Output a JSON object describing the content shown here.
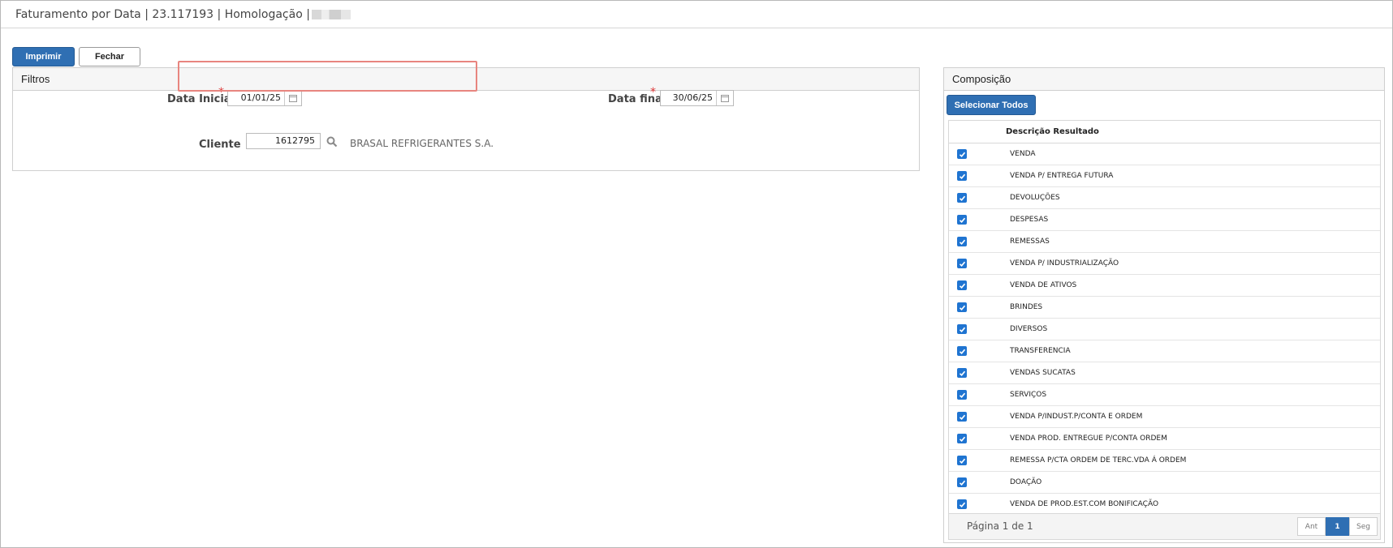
{
  "window": {
    "title": "Faturamento por Data | 23.117193 | Homologação |"
  },
  "toolbar": {
    "print_label": "Imprimir",
    "close_label": "Fechar"
  },
  "filtros": {
    "title": "Filtros",
    "data_inicial_label": "Data Inicial",
    "data_inicial_value": "01/01/25",
    "data_final_label": "Data final",
    "data_final_value": "30/06/25",
    "required_mark": "*",
    "cliente_label": "Cliente",
    "cliente_code": "1612795",
    "cliente_name": "BRASAL REFRIGERANTES S.A."
  },
  "composicao": {
    "title": "Composição",
    "select_all_label": "Selecionar Todos",
    "column_header": "Descrição Resultado",
    "items": [
      {
        "label": "VENDA",
        "checked": true
      },
      {
        "label": "VENDA P/ ENTREGA FUTURA",
        "checked": true
      },
      {
        "label": "DEVOLUÇÕES",
        "checked": true
      },
      {
        "label": "DESPESAS",
        "checked": true
      },
      {
        "label": "REMESSAS",
        "checked": true
      },
      {
        "label": "VENDA P/ INDUSTRIALIZAÇÃO",
        "checked": true
      },
      {
        "label": "VENDA DE ATIVOS",
        "checked": true
      },
      {
        "label": "BRINDES",
        "checked": true
      },
      {
        "label": "DIVERSOS",
        "checked": true
      },
      {
        "label": "TRANSFERENCIA",
        "checked": true
      },
      {
        "label": "VENDAS SUCATAS",
        "checked": true
      },
      {
        "label": "SERVIÇOS",
        "checked": true
      },
      {
        "label": "VENDA P/INDUST.P/CONTA E ORDEM",
        "checked": true
      },
      {
        "label": "VENDA PROD. ENTREGUE P/CONTA ORDEM",
        "checked": true
      },
      {
        "label": "REMESSA P/CTA ORDEM DE TERC.VDA Á ORDEM",
        "checked": true
      },
      {
        "label": "DOAÇÃO",
        "checked": true
      },
      {
        "label": "VENDA DE PROD.EST.COM BONIFICAÇÃO",
        "checked": true
      }
    ],
    "pagination": {
      "info": "Página 1 de 1",
      "prev_label": "Ant",
      "current_page": "1",
      "next_label": "Seg"
    }
  },
  "colors": {
    "primary": "#2f6fb3",
    "checkbox": "#1f74d1",
    "highlight_border": "#e8857f",
    "required": "#dd3333"
  }
}
